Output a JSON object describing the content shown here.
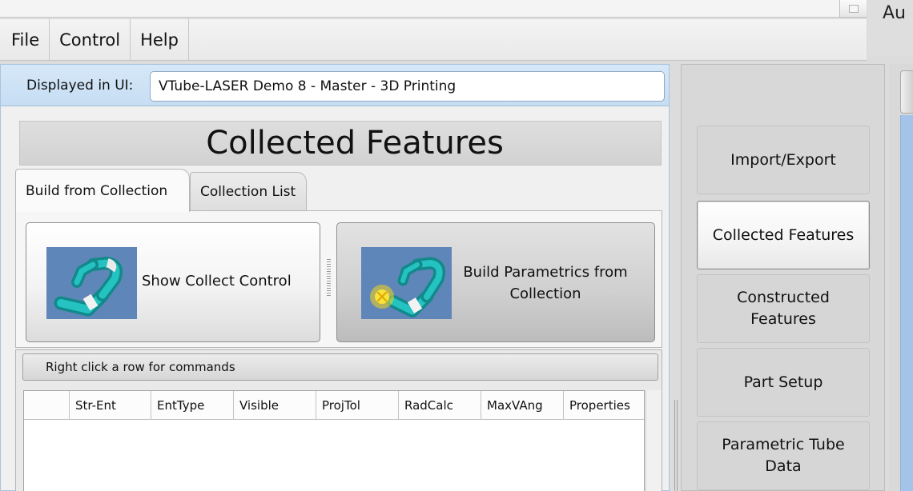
{
  "window": {
    "right_edge_text": "Au"
  },
  "menu": {
    "file": "File",
    "control": "Control",
    "help": "Help"
  },
  "display": {
    "label": "Displayed in UI:",
    "value": "VTube-LASER Demo 8 - Master - 3D Printing"
  },
  "panel": {
    "title": "Collected Features"
  },
  "tabs": [
    {
      "label": "Build from Collection",
      "active": true
    },
    {
      "label": "Collection List",
      "active": false
    }
  ],
  "actions": {
    "show_collect": "Show Collect Control",
    "build_parametrics_line1": "Build Parametrics from",
    "build_parametrics_line2": "Collection"
  },
  "grid": {
    "hint": "Right click a row for commands",
    "columns": [
      "",
      "Str-Ent",
      "EntType",
      "Visible",
      "ProjTol",
      "RadCalc",
      "MaxVAng",
      "Properties"
    ]
  },
  "nav": {
    "import_export": "Import/Export",
    "collected": "Collected Features",
    "constructed_line1": "Constructed",
    "constructed_line2": "Features",
    "part_setup": "Part Setup",
    "parametric_line1": "Parametric Tube",
    "parametric_line2": "Data"
  },
  "colors": {
    "accent_blue": "#c6ddf3",
    "icon_background": "#5f86b8",
    "tube_teal": "#1aa7a8"
  }
}
